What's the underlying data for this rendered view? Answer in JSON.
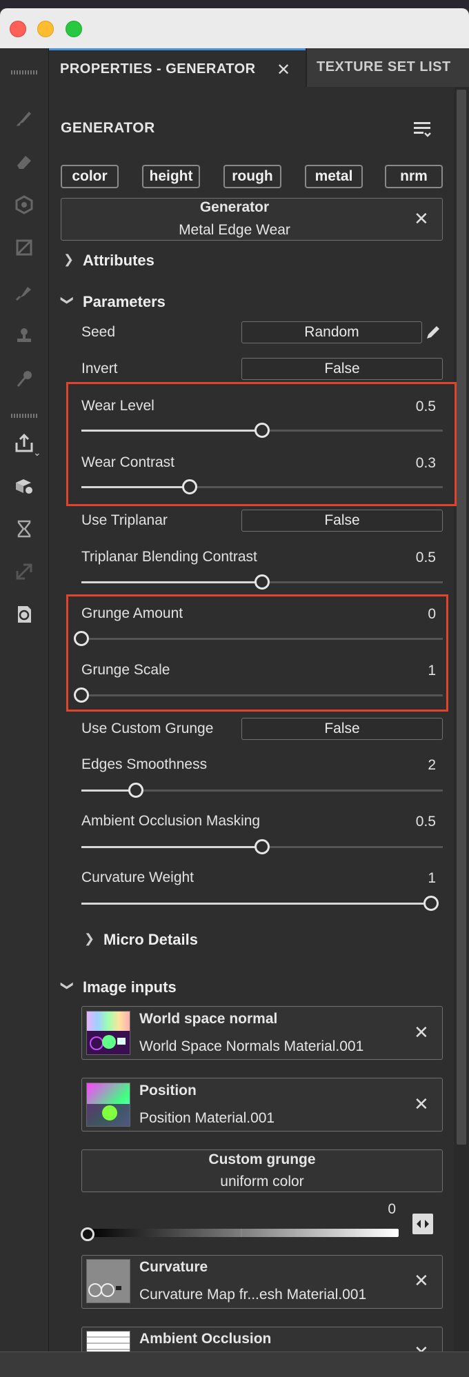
{
  "tabs": {
    "active": "PROPERTIES - GENERATOR",
    "second": "TEXTURE SET LIST"
  },
  "panel": {
    "title": "GENERATOR",
    "channels": [
      "color",
      "height",
      "rough",
      "metal",
      "nrm"
    ],
    "generator_card": {
      "title": "Generator",
      "subtitle": "Metal Edge Wear"
    },
    "attributes_label": "Attributes",
    "parameters_label": "Parameters",
    "params": {
      "seed": {
        "label": "Seed",
        "value": "Random"
      },
      "invert": {
        "label": "Invert",
        "value": "False"
      },
      "wear_level": {
        "label": "Wear Level",
        "value": "0.5",
        "fraction": 0.5
      },
      "wear_contrast": {
        "label": "Wear Contrast",
        "value": "0.3",
        "fraction": 0.3
      },
      "use_triplanar": {
        "label": "Use Triplanar",
        "value": "False"
      },
      "triplanar_blend": {
        "label": "Triplanar Blending Contrast",
        "value": "0.5",
        "fraction": 0.5
      },
      "grunge_amount": {
        "label": "Grunge Amount",
        "value": "0",
        "fraction": 0.0
      },
      "grunge_scale": {
        "label": "Grunge Scale",
        "value": "1",
        "fraction": 0.0
      },
      "use_custom_grunge": {
        "label": "Use Custom Grunge",
        "value": "False"
      },
      "edges_smoothness": {
        "label": "Edges Smoothness",
        "value": "2",
        "fraction": 0.15
      },
      "ao_masking": {
        "label": "Ambient Occlusion Masking",
        "value": "0.5",
        "fraction": 0.5
      },
      "curvature_weight": {
        "label": "Curvature Weight",
        "value": "1",
        "fraction": 1.0
      }
    },
    "micro_details_label": "Micro Details",
    "image_inputs_label": "Image inputs",
    "inputs": {
      "world_normal": {
        "title": "World space normal",
        "subtitle": "World Space Normals Material.001"
      },
      "position": {
        "title": "Position",
        "subtitle": "Position Material.001"
      },
      "custom_grunge": {
        "title": "Custom grunge",
        "subtitle": "uniform color",
        "value": "0",
        "fraction": 0.0
      },
      "curvature": {
        "title": "Curvature",
        "subtitle": "Curvature Map fr...esh Material.001"
      },
      "ao": {
        "title": "Ambient Occlusion"
      }
    }
  },
  "colors": {
    "highlight": "#e0442c",
    "tab_accent": "#4a90d9"
  }
}
